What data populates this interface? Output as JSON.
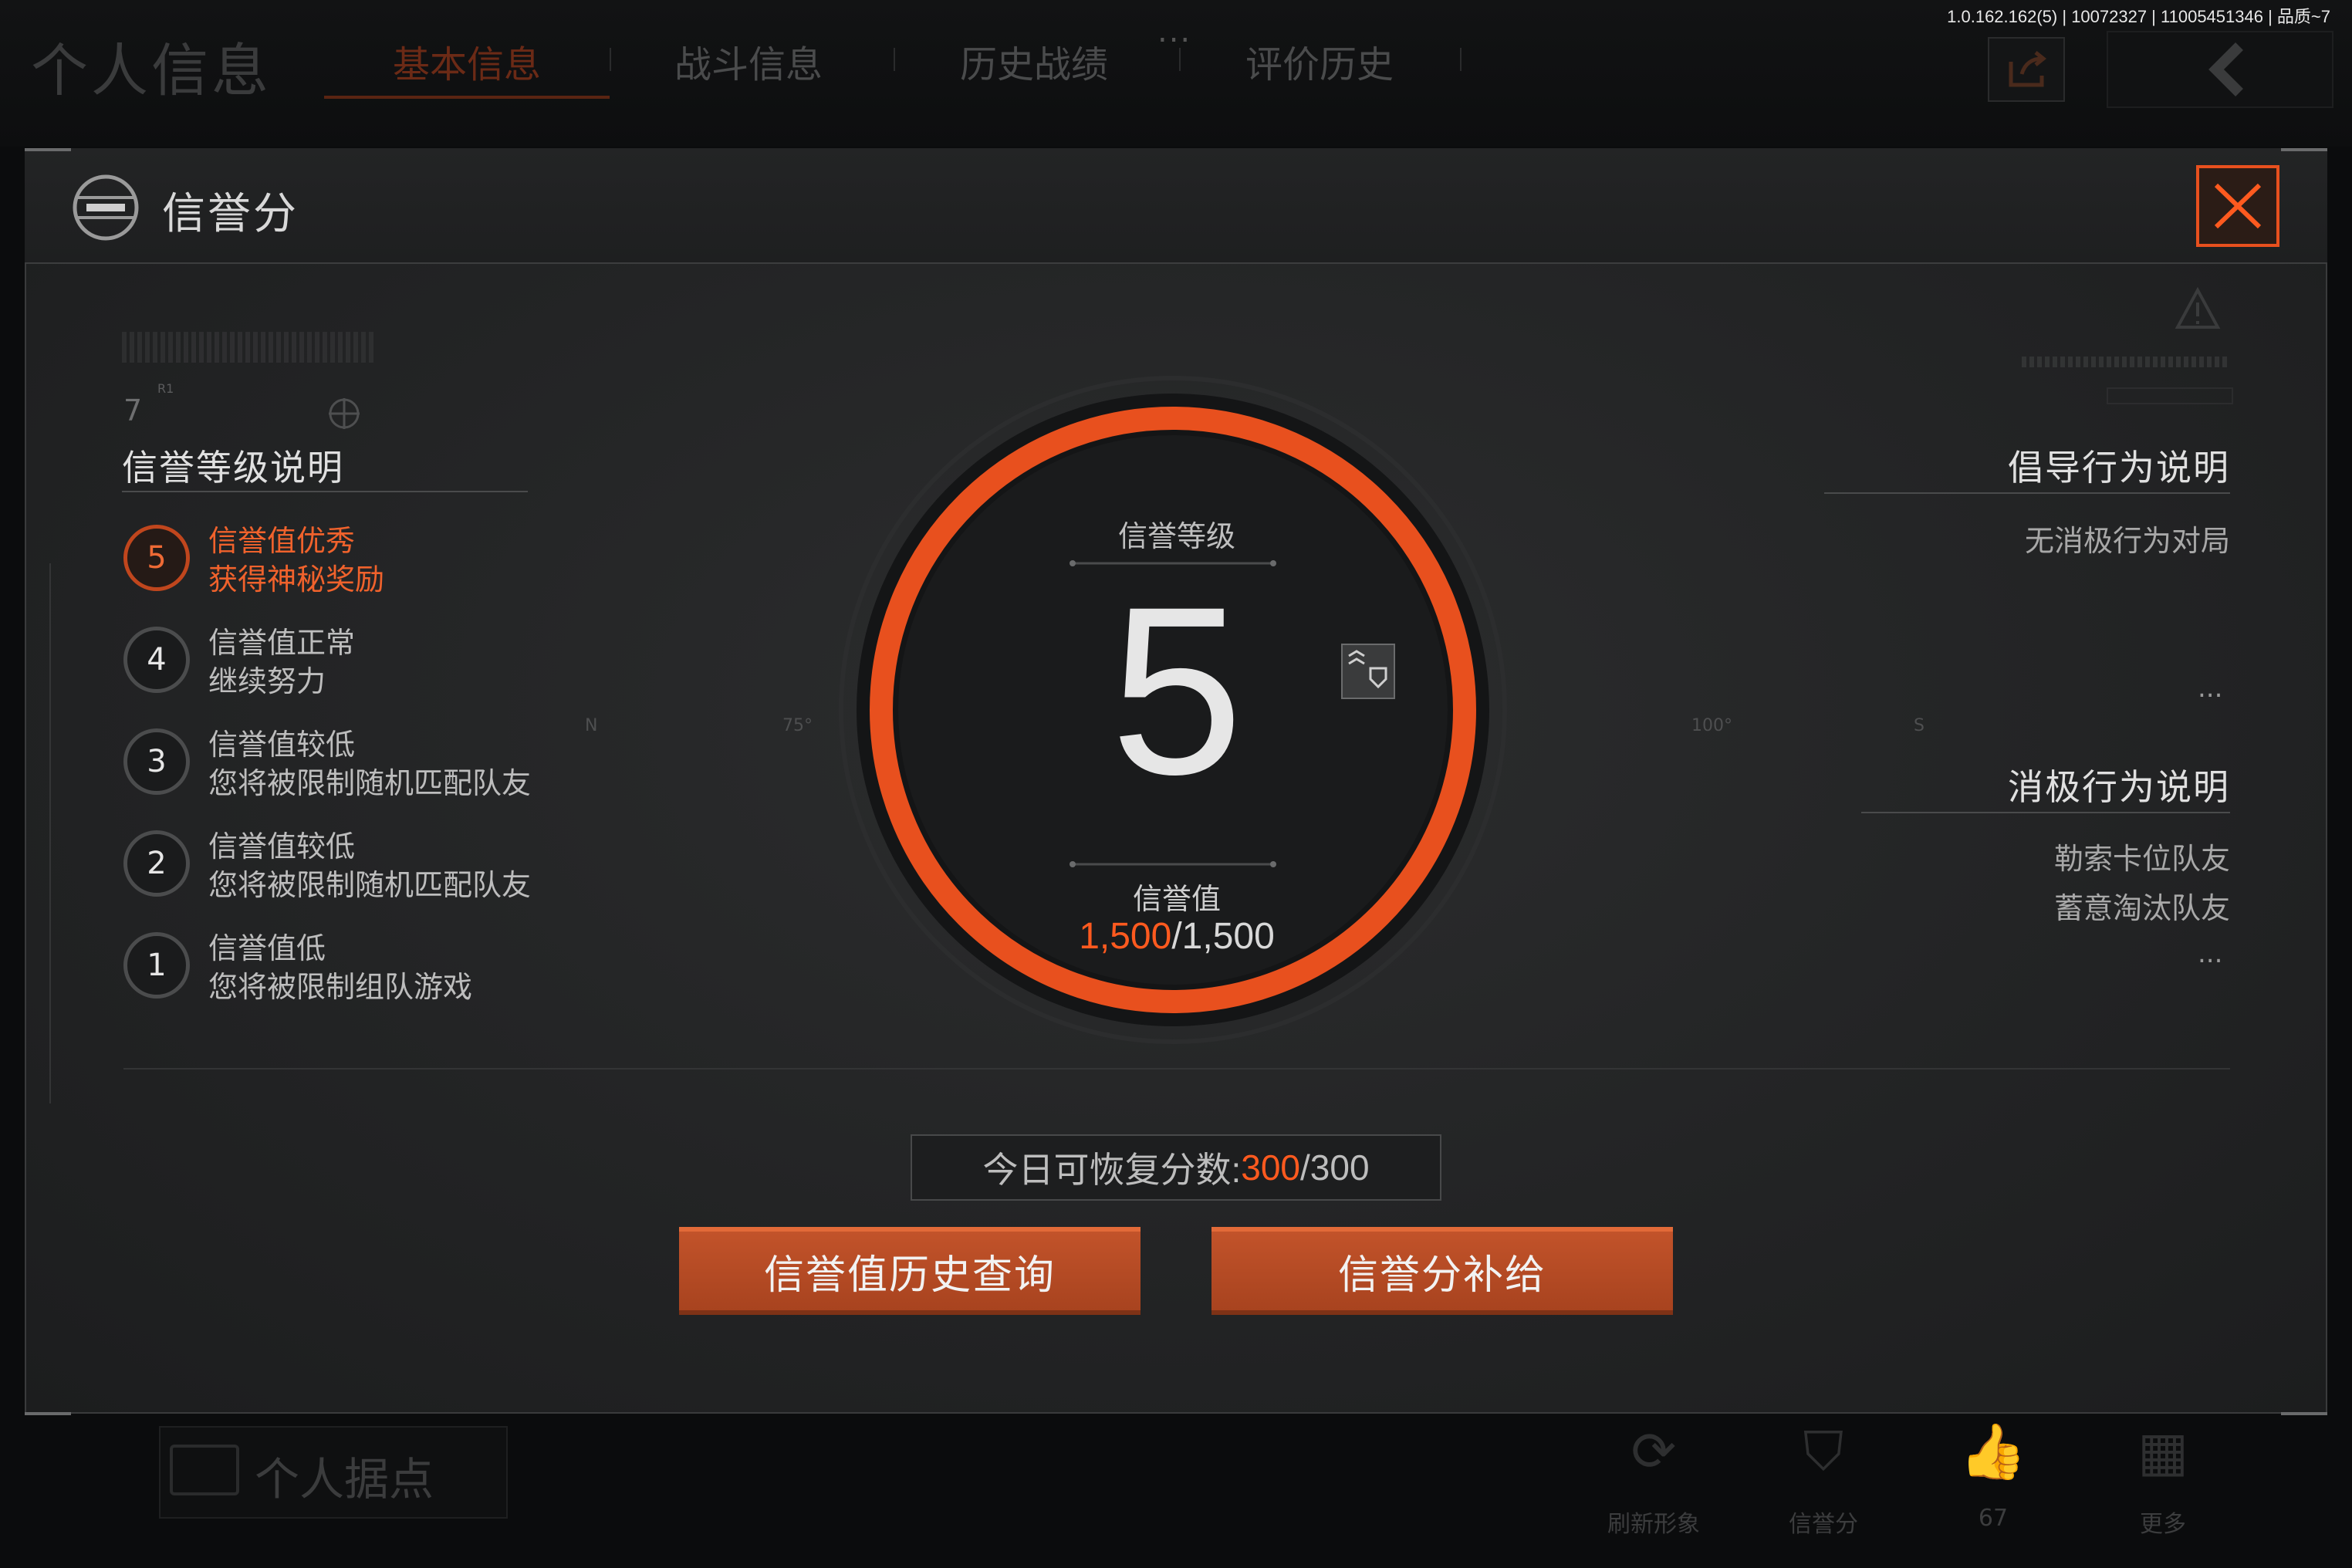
{
  "version": "1.0.162.162(5) | 10072327 | 11005451346 | 品质~7",
  "background": {
    "title": "个人信息",
    "tabs": [
      "基本信息",
      "战斗信息",
      "历史战绩",
      "评价历史"
    ],
    "overflow": "...",
    "base_label": "个人据点",
    "actions": [
      {
        "label": "刷新形象",
        "icon": "refresh-icon"
      },
      {
        "label": "信誉分",
        "icon": "credit-shield-icon"
      },
      {
        "label": "67",
        "icon": "thumbs-up-icon"
      },
      {
        "label": "更多",
        "icon": "grid-icon"
      }
    ]
  },
  "dialog": {
    "title": "信誉分",
    "left": {
      "small_number": "7",
      "small_label": "R1",
      "heading": "信誉等级说明",
      "levels": [
        {
          "num": "5",
          "line1": "信誉值优秀",
          "line2": "获得神秘奖励",
          "active": true
        },
        {
          "num": "4",
          "line1": "信誉值正常",
          "line2": "继续努力",
          "active": false
        },
        {
          "num": "3",
          "line1": "信誉值较低",
          "line2": "您将被限制随机匹配队友",
          "active": false
        },
        {
          "num": "2",
          "line1": "信誉值较低",
          "line2": "您将被限制随机匹配队友",
          "active": false
        },
        {
          "num": "1",
          "line1": "信誉值低",
          "line2": "您将被限制组队游戏",
          "active": false
        }
      ]
    },
    "center": {
      "label": "信誉等级",
      "level": "5",
      "value_label": "信誉值",
      "value_current": "1,500",
      "value_max": "/1,500",
      "compass": [
        "N",
        "75°",
        "100°",
        "S"
      ]
    },
    "right": {
      "positive_heading": "倡导行为说明",
      "positive_items": [
        "无消极行为对局"
      ],
      "positive_more": "...",
      "negative_heading": "消极行为说明",
      "negative_items": [
        "勒索卡位队友",
        "蓄意淘汰队友"
      ],
      "negative_more": "..."
    },
    "recovery": {
      "label": "今日可恢复分数:",
      "current": "300",
      "max": "/300"
    },
    "buttons": {
      "history": "信誉值历史查询",
      "supply": "信誉分补给"
    }
  },
  "colors": {
    "accent": "#ff5a1f",
    "ring": "#e8501e",
    "panel": "#262728"
  }
}
